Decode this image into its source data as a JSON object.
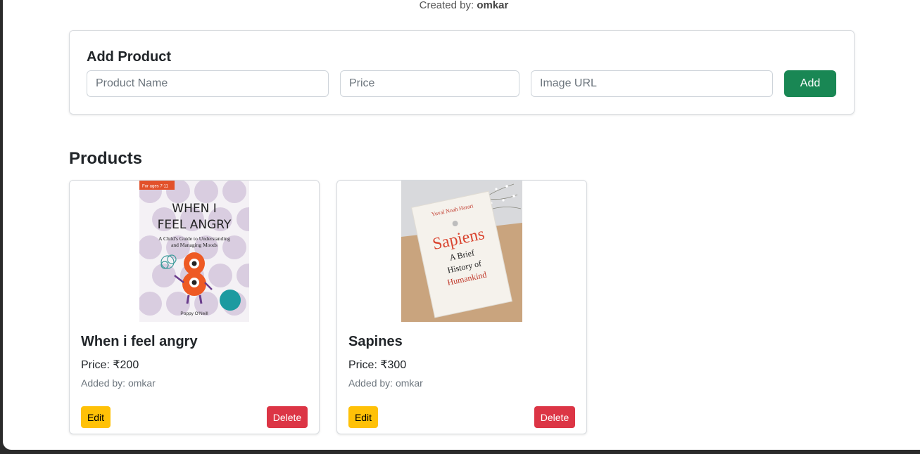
{
  "header": {
    "created_by_prefix": "Created by: ",
    "created_by_name": "omkar"
  },
  "add_product": {
    "title": "Add Product",
    "name_placeholder": "Product Name",
    "price_placeholder": "Price",
    "image_placeholder": "Image URL",
    "add_label": "Add"
  },
  "products_section": {
    "heading": "Products"
  },
  "products": [
    {
      "name": "When i feel angry",
      "price": "Price: ₹200",
      "added_by": "Added by: omkar",
      "edit_label": "Edit",
      "delete_label": "Delete",
      "cover": {
        "tag": "For ages 7-11",
        "title_line1": "WHEN I",
        "title_line2": "FEEL ANGRY",
        "subtitle_line1": "A Child's Guide to Understanding",
        "subtitle_line2": "and Managing Moods",
        "author": "Poppy O'Neill"
      }
    },
    {
      "name": "Sapines",
      "price": "Price: ₹300",
      "added_by": "Added by: omkar",
      "edit_label": "Edit",
      "delete_label": "Delete",
      "cover": {
        "author": "Yuval Noah Harari",
        "title": "Sapiens",
        "subtitle_line1": "A Brief",
        "subtitle_line2": "History of",
        "subtitle_line3": "Humankind"
      }
    }
  ],
  "colors": {
    "add_button": "#198754",
    "edit_button": "#ffc107",
    "delete_button": "#dc3545"
  }
}
